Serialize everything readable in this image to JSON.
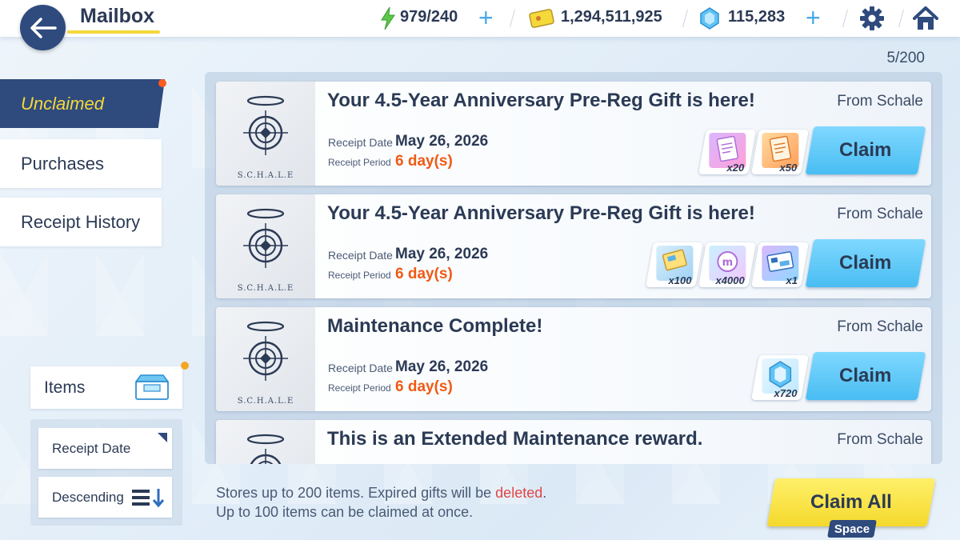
{
  "header": {
    "title": "Mailbox",
    "back_icon": "arrow-left-icon",
    "ap": "979/240",
    "credits": "1,294,511,925",
    "pyroxene": "115,283",
    "plus": "+"
  },
  "mail_count": "5/200",
  "nav": {
    "unclaimed": "Unclaimed",
    "purchases": "Purchases",
    "receipt_history": "Receipt History"
  },
  "filters": {
    "items": "Items",
    "sort_by": "Receipt Date",
    "order": "Descending"
  },
  "mails": [
    {
      "title": "Your 4.5-Year Anniversary Pre-Reg Gift is here!",
      "from": "From Schale",
      "receipt_date_label": "Receipt Date",
      "receipt_date": "May 26, 2026",
      "receipt_period_label": "Receipt Period",
      "receipt_period": "6 day(s)",
      "claim": "Claim",
      "rewards": [
        {
          "icon": "report-pink-icon",
          "qty": "x20"
        },
        {
          "icon": "report-orange-icon",
          "qty": "x50"
        }
      ]
    },
    {
      "title": "Your 4.5-Year Anniversary Pre-Reg Gift is here!",
      "from": "From Schale",
      "receipt_date_label": "Receipt Date",
      "receipt_date": "May 26, 2026",
      "receipt_period_label": "Receipt Period",
      "receipt_period": "6 day(s)",
      "claim": "Claim",
      "rewards": [
        {
          "icon": "ticket-icon",
          "qty": "x100"
        },
        {
          "icon": "coin-m-icon",
          "qty": "x4000"
        },
        {
          "icon": "card-icon",
          "qty": "x1"
        }
      ]
    },
    {
      "title": "Maintenance Complete!",
      "from": "From Schale",
      "receipt_date_label": "Receipt Date",
      "receipt_date": "May 26, 2026",
      "receipt_period_label": "Receipt Period",
      "receipt_period": "6 day(s)",
      "claim": "Claim",
      "rewards": [
        {
          "icon": "pyroxene-icon",
          "qty": "x720"
        }
      ]
    },
    {
      "title": "This is an Extended Maintenance reward.",
      "from": "From Schale"
    }
  ],
  "schale_logo_text": "S.C.H.A.L.E",
  "footer": {
    "line1_prefix": "Stores up to 200 items. Expired gifts will be ",
    "line1_deleted": "deleted",
    "line1_suffix": ".",
    "line2": "Up to 100 items can be claimed at once."
  },
  "claim_all": "Claim All",
  "space_key": "Space"
}
